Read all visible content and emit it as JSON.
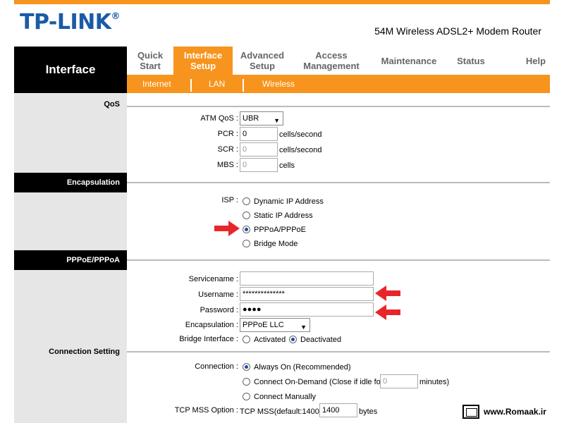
{
  "brand": {
    "logo": "TP-LINK",
    "trademark": "®",
    "model": "54M Wireless ADSL2+ Modem Router"
  },
  "nav": {
    "section": "Interface",
    "tabs": [
      {
        "label": "Quick Start"
      },
      {
        "label": "Interface Setup",
        "active": true
      },
      {
        "label": "Advanced Setup"
      },
      {
        "label": "Access Management"
      },
      {
        "label": "Maintenance"
      },
      {
        "label": "Status"
      },
      {
        "label": "Help"
      }
    ],
    "subtabs": [
      {
        "label": "Internet"
      },
      {
        "label": "LAN"
      },
      {
        "label": "Wireless"
      }
    ]
  },
  "qos": {
    "title": "QoS",
    "atm_label": "ATM QoS",
    "atm_value": "UBR",
    "pcr_label": "PCR",
    "pcr_value": "0",
    "scr_label": "SCR",
    "scr_value": "0",
    "mbs_label": "MBS",
    "mbs_value": "0",
    "cells_per_second": "cells/second",
    "cells": "cells"
  },
  "encapsulation": {
    "title": "Encapsulation",
    "isp_label": "ISP",
    "options": [
      "Dynamic IP Address",
      "Static IP Address",
      "PPPoA/PPPoE",
      "Bridge Mode"
    ],
    "selected": "PPPoA/PPPoE"
  },
  "pppoe": {
    "title": "PPPoE/PPPoA",
    "servicename_label": "Servicename",
    "servicename_value": "",
    "username_label": "Username",
    "username_value": "**************",
    "password_label": "Password",
    "password_value": "●●●●",
    "encapsulation_label": "Encapsulation",
    "encapsulation_value": "PPPoE LLC",
    "bridge_label": "Bridge Interface",
    "bridge_activated": "Activated",
    "bridge_deactivated": "Deactivated",
    "bridge_selected": "Deactivated"
  },
  "connection": {
    "title": "Connection Setting",
    "connection_label": "Connection",
    "always_on": "Always On (Recommended)",
    "on_demand": "Connect On-Demand (Close if idle for",
    "on_demand_value": "0",
    "minutes": "minutes)",
    "manually": "Connect Manually",
    "selected": "Always On (Recommended)",
    "tcp_mss_label": "TCP MSS Option",
    "tcp_mss_text": "TCP MSS(default:1400)",
    "tcp_mss_value": "1400",
    "bytes": "bytes"
  },
  "watermark": {
    "site": "www.Romaak.ir"
  },
  "colors": {
    "accent": "#f7941d",
    "brand_blue": "#1a5ba6",
    "arrow_red": "#e8262a"
  }
}
